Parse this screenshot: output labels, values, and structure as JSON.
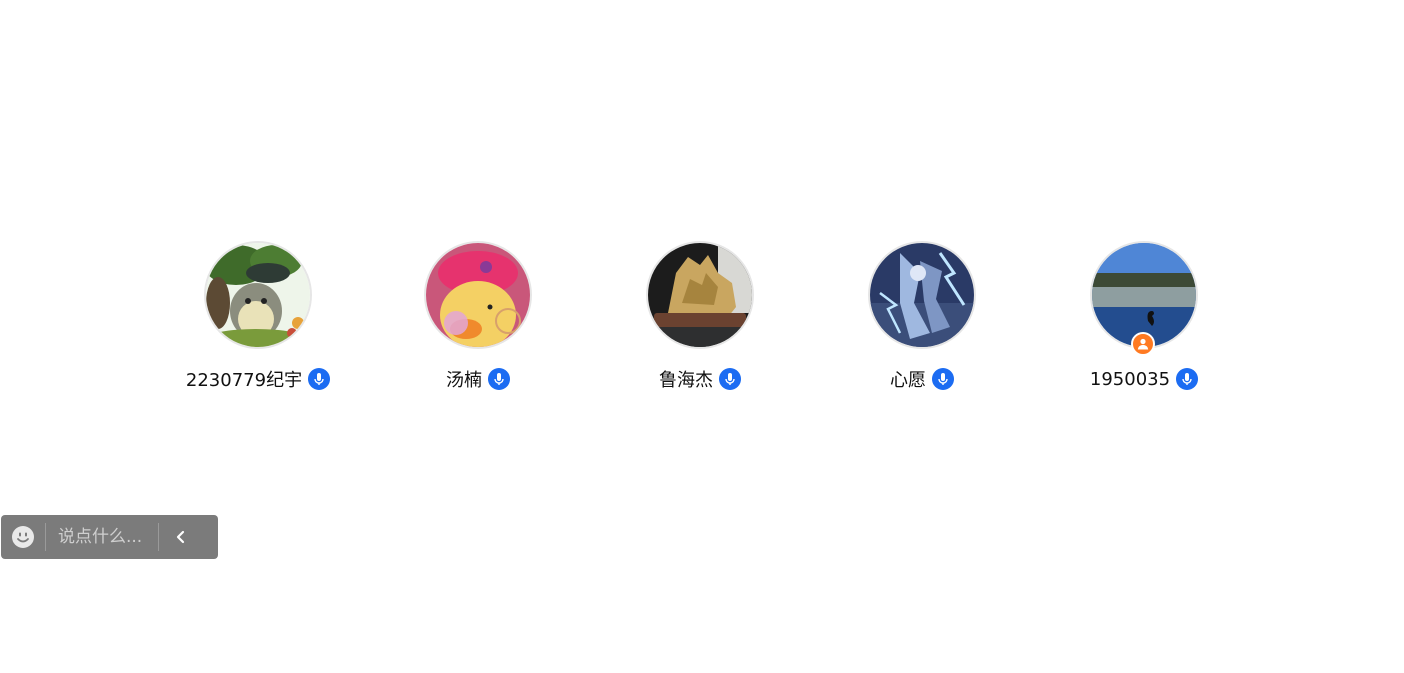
{
  "participants": [
    {
      "name": "2230779纪宇",
      "avatar_icon": "totoro-photo-avatar",
      "mic_icon": "mic-icon",
      "is_host": false
    },
    {
      "name": "汤楠",
      "avatar_icon": "duck-toy-photo-avatar",
      "mic_icon": "mic-icon",
      "is_host": false
    },
    {
      "name": "鲁海杰",
      "avatar_icon": "rock-sculpture-photo-avatar",
      "mic_icon": "mic-icon",
      "is_host": false
    },
    {
      "name": "心愿",
      "avatar_icon": "game-character-photo-avatar",
      "mic_icon": "mic-icon",
      "is_host": false
    },
    {
      "name": "1950035",
      "avatar_icon": "lake-swan-photo-avatar",
      "mic_icon": "mic-icon",
      "is_host": true,
      "host_icon": "host-user-icon"
    }
  ],
  "chat": {
    "placeholder": "说点什么...",
    "emoji_icon": "smiley-icon",
    "collapse_icon": "chevron-left-icon"
  },
  "colors": {
    "mic_badge": "#1c6cf2",
    "host_badge": "#ff7a22",
    "chat_bar_bg": "#7b7b7b"
  }
}
